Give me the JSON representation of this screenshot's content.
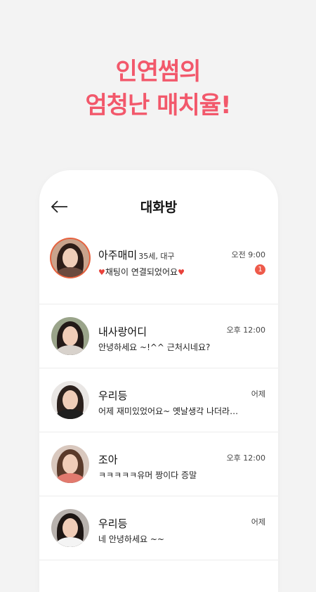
{
  "headline": {
    "line1": "인연썸의",
    "line2": "엄청난 매치율!",
    "color": "#f2586b"
  },
  "screen": {
    "title": "대화방",
    "back_icon": "arrow-left-icon"
  },
  "chats": [
    {
      "name": "아주매미",
      "meta": "35세, 대구",
      "message": "채팅이 연결되었어요",
      "time": "오전 9:00",
      "unread": "1",
      "heart": "♥"
    },
    {
      "name": "내사랑어디",
      "meta": "",
      "message": "안녕하세요 ~!^^ 근처시네요?",
      "time": "오후 12:00"
    },
    {
      "name": "우리등",
      "meta": "",
      "message": "어제 재미있었어요~ 옛날생각 나더라구…",
      "time": "어제"
    },
    {
      "name": "조아",
      "meta": "",
      "message": "ㅋㅋㅋㅋㅋ유머 짱이다 증말",
      "time": "오후 12:00"
    },
    {
      "name": "우리등",
      "meta": "",
      "message": "네 안녕하세요 ~~",
      "time": "어제"
    }
  ]
}
